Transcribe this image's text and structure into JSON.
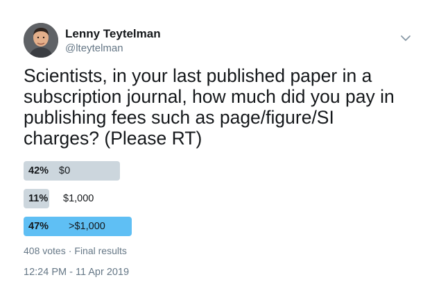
{
  "author": {
    "name": "Lenny Teytelman",
    "handle": "@lteytelman",
    "avatar_icon": "user-photo-avatar"
  },
  "tweet": {
    "text": "Scientists, in your last published paper in a subscription journal, how much did you pay in publishing fees such as page/figure/SI charges? (Please RT)"
  },
  "poll": {
    "options": [
      {
        "percent": "42%",
        "label": "$0",
        "fraction": 0.42,
        "winner": false
      },
      {
        "percent": "11%",
        "label": "$1,000",
        "fraction": 0.11,
        "winner": false
      },
      {
        "percent": "47%",
        "label": ">$1,000",
        "fraction": 0.47,
        "winner": true
      }
    ],
    "votes": "408 votes",
    "separator": "·",
    "status": "Final results"
  },
  "timestamp": "12:24 PM - 11 Apr 2019",
  "colors": {
    "bar": "#ccd6dd",
    "winner_bar": "#5fbff4",
    "secondary_text": "#657786"
  },
  "icons": {
    "menu": "chevron-down-icon"
  }
}
